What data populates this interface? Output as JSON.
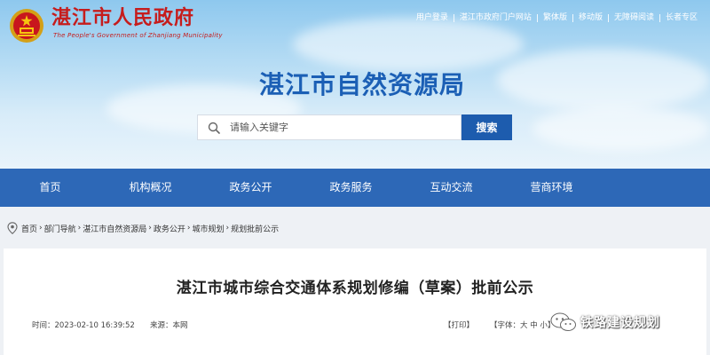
{
  "header": {
    "gov_name": "湛江市人民政府",
    "gov_subtitle": "The People's Government of Zhanjiang Municipality",
    "bureau_name": "湛江市自然资源局",
    "toplinks": [
      "用户登录",
      "湛江市政府门户网站",
      "繁体版",
      "移动版",
      "无障碍阅读",
      "长者专区"
    ]
  },
  "search": {
    "placeholder": "请输入关键字",
    "button_label": "搜索"
  },
  "nav": {
    "items": [
      "首页",
      "机构概况",
      "政务公开",
      "政务服务",
      "互动交流",
      "营商环境"
    ]
  },
  "breadcrumb": {
    "items": [
      "首页",
      "部门导航",
      "湛江市自然资源局",
      "政务公开",
      "城市规划",
      "规划批前公示"
    ],
    "separator": "›"
  },
  "article": {
    "title": "湛江市城市综合交通体系规划修编（草案）批前公示",
    "time": "时间：2023-02-10 16:39:52",
    "source": "来源：本网",
    "print": "【打印】",
    "font_size": "【字体：大 中 小】"
  },
  "watermark": {
    "text": "铁路建设规划"
  },
  "colors": {
    "nav_bg": "#2d68b7",
    "title_blue": "#1b5fb5",
    "gov_red": "#c61c1c",
    "search_btn": "#1d5cae"
  }
}
